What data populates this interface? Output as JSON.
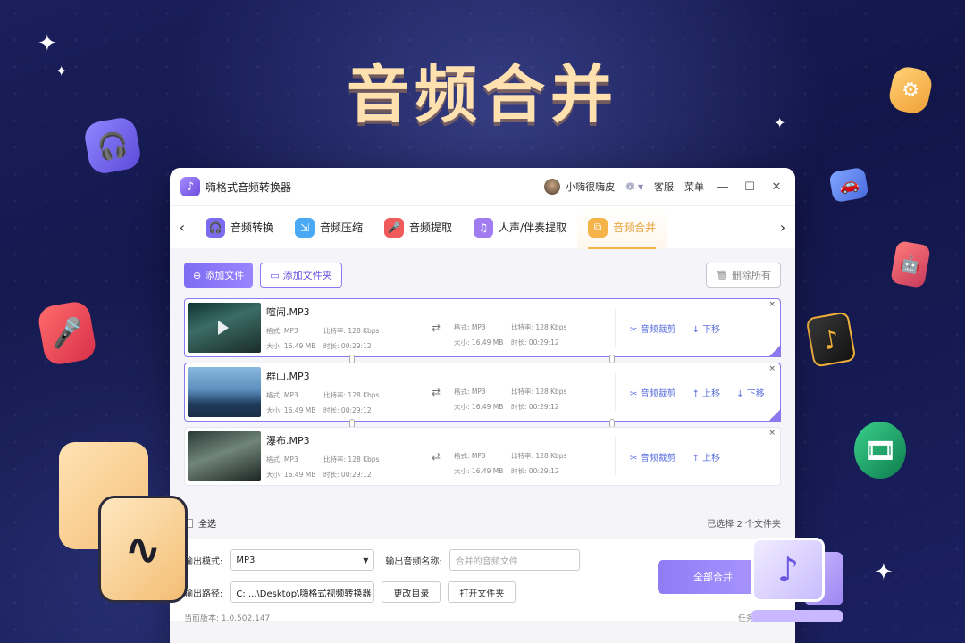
{
  "hero_title": "音频合并",
  "icons": {
    "sparkle": "✦",
    "headphone": "🎧",
    "mic": "🎤",
    "gear": "⚙",
    "car": "🚗",
    "robot": "🤖",
    "note": "♪",
    "film": "🎞",
    "wave": "∿",
    "monitor_note": "♪"
  },
  "window": {
    "app_title": "嗨格式音频转换器",
    "user_name": "小嗨很嗨皮",
    "vip_icon": "❁ ▾",
    "support": "客服",
    "menu": "菜单",
    "minimize": "—",
    "maximize": "☐",
    "close": "✕"
  },
  "tabs": [
    {
      "label": "音频转换",
      "color": "#7b6cf0",
      "icon": "🎧"
    },
    {
      "label": "音频压缩",
      "color": "#4aa9f5",
      "icon": "⇲"
    },
    {
      "label": "音频提取",
      "color": "#f05a5a",
      "icon": "🎤"
    },
    {
      "label": "人声/伴奏提取",
      "color": "#a07cf0",
      "icon": "♫"
    },
    {
      "label": "音频合并",
      "color": "#f5b44a",
      "icon": "⧉"
    }
  ],
  "tab_arrows": {
    "left": "‹",
    "right": "›"
  },
  "toolbar": {
    "add_file": "添加文件",
    "add_file_icon": "⊕",
    "add_folder": "添加文件夹",
    "add_folder_icon": "▭",
    "delete_all": "删除所有",
    "delete_icon": "🗑"
  },
  "labels": {
    "format": "格式:",
    "bitrate": "比特率:",
    "size": "大小:",
    "duration": "时长:",
    "trim": "音频裁剪",
    "move_up": "上移",
    "move_down": "下移",
    "trim_icon": "✂",
    "up_icon": "↑",
    "down_icon": "↓",
    "shuffle_icon": "⇄",
    "close_icon": "×"
  },
  "files": [
    {
      "name": "喧闹.MP3",
      "format": "MP3",
      "bitrate": "128 Kbps",
      "size": "16.49 MB",
      "duration": "00:29:12",
      "out_format": "MP3",
      "out_bitrate": "128 Kbps",
      "out_size": "16.49 MB",
      "out_duration": "00:29:12",
      "selected": true
    },
    {
      "name": "群山.MP3",
      "format": "MP3",
      "bitrate": "128 Kbps",
      "size": "16.49 MB",
      "duration": "00:29:12",
      "out_format": "MP3",
      "out_bitrate": "128 Kbps",
      "out_size": "16.49 MB",
      "out_duration": "00:29:12",
      "selected": true
    },
    {
      "name": "瀑布.MP3",
      "format": "MP3",
      "bitrate": "128 Kbps",
      "size": "16.49 MB",
      "duration": "00:29:12",
      "out_format": "MP3",
      "out_bitrate": "128 Kbps",
      "out_size": "16.49 MB",
      "out_duration": "00:29:12",
      "selected": false
    }
  ],
  "select_all": "全选",
  "selected_count": "已选择 2 个文件夹",
  "output": {
    "mode_label": "输出模式:",
    "mode_value": "MP3",
    "name_label": "输出音频名称:",
    "name_placeholder": "合并的音频文件",
    "path_label": "输出路径:",
    "path_value": "C: ...\\Desktop\\嗨格式视频转换器",
    "change_dir": "更改目录",
    "open_folder": "打开文件夹",
    "merge_all": "全部合并"
  },
  "footer": {
    "version": "当前版本: 1.0.502.147",
    "after_task": "任务完成后:"
  },
  "colors": {
    "accent": "#8b79f0",
    "hero": "#ffe1b0",
    "link": "#5b6fe0"
  }
}
